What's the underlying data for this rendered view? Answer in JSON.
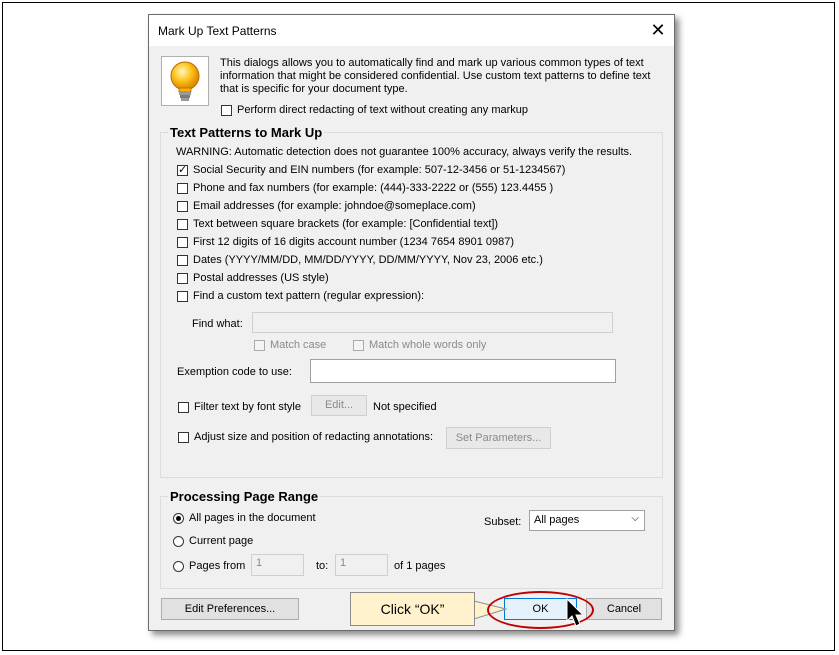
{
  "dialog": {
    "title": "Mark Up Text Patterns",
    "close_icon": "close-icon",
    "info_icon": "lightbulb-icon",
    "intro_text": "This dialogs allows you to automatically find and mark up various common types of text information that might be considered confidential. Use custom text patterns to define text that is specific for your document type.",
    "direct_redact_label": "Perform direct redacting of text without creating any markup",
    "direct_redact_checked": false
  },
  "patterns": {
    "title": "Text Patterns to Mark Up",
    "warning": "WARNING: Automatic detection does not guarantee 100% accuracy, always verify the results.",
    "items": [
      {
        "label": "Social Security and EIN numbers (for example: 507-12-3456 or 51-1234567)",
        "checked": true
      },
      {
        "label": "Phone and fax numbers (for example: (444)-333-2222 or (555) 123.4455 )",
        "checked": false
      },
      {
        "label": "Email addresses (for example: johndoe@someplace.com)",
        "checked": false
      },
      {
        "label": "Text between square brackets (for example: [Confidential text])",
        "checked": false
      },
      {
        "label": "First 12 digits of 16 digits account number (1234 7654 8901 0987)",
        "checked": false
      },
      {
        "label": "Dates (YYYY/MM/DD, MM/DD/YYYY, DD/MM/YYYY, Nov 23, 2006 etc.)",
        "checked": false
      },
      {
        "label": "Postal addresses (US style)",
        "checked": false
      },
      {
        "label": "Find a custom text pattern (regular expression):",
        "checked": false
      }
    ],
    "find_what_label": "Find what:",
    "find_what_value": "",
    "match_case_label": "Match case",
    "match_whole_label": "Match whole words only",
    "exemption_label": "Exemption code to use:",
    "exemption_value": "",
    "filter_font_label": "Filter text by font style",
    "edit_button": "Edit...",
    "not_specified": "Not specified",
    "adjust_label": "Adjust size and position of redacting annotations:",
    "set_params_button": "Set Parameters..."
  },
  "page_range": {
    "title": "Processing Page Range",
    "all_pages": "All pages in the document",
    "current_page": "Current page",
    "pages_from": "Pages from",
    "from_value": "1",
    "to_label": "to:",
    "to_value": "1",
    "of_pages": "of 1 pages",
    "subset_label": "Subset:",
    "subset_value": "All pages",
    "selected": "all"
  },
  "footer": {
    "edit_prefs": "Edit Preferences...",
    "ok": "OK",
    "cancel": "Cancel"
  },
  "annotation": {
    "callout_text": "Click “OK”",
    "highlight_color": "#c00000",
    "callout_color": "#fff2cc"
  }
}
